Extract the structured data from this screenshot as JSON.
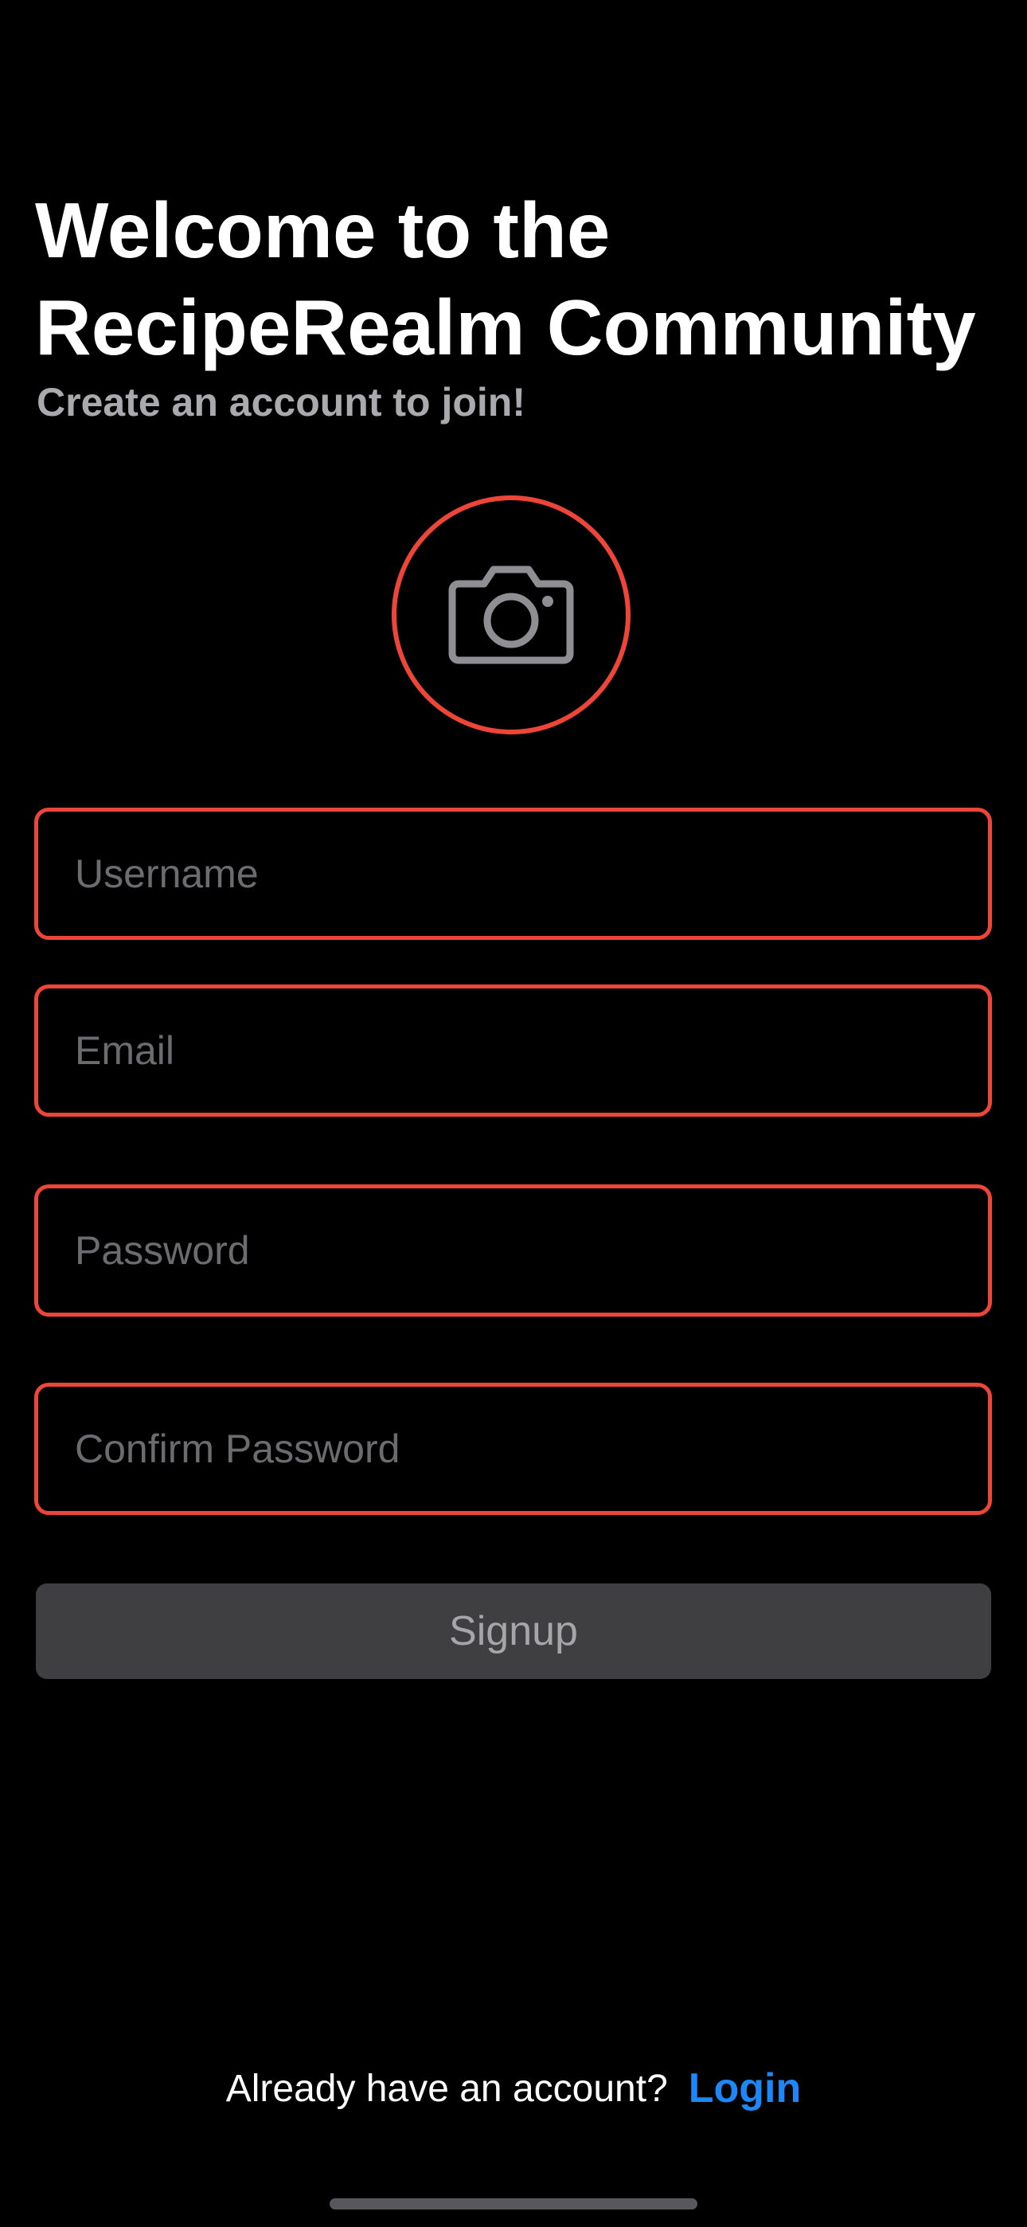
{
  "header": {
    "title": "Welcome to the RecipeRealm Community",
    "subtitle": "Create an account to join!"
  },
  "avatar": {
    "icon": "camera-icon",
    "accent_color": "#ee4539"
  },
  "form": {
    "username_placeholder": "Username",
    "username_value": "",
    "email_placeholder": "Email",
    "email_value": "",
    "password_placeholder": "Password",
    "password_value": "",
    "confirm_password_placeholder": "Confirm Password",
    "confirm_password_value": "",
    "field_border_color": "#ee4539"
  },
  "signup_button": {
    "label": "Signup",
    "state": "disabled"
  },
  "footer": {
    "prompt": "Already have an account?",
    "login_label": "Login",
    "link_color": "#1d87f7"
  }
}
